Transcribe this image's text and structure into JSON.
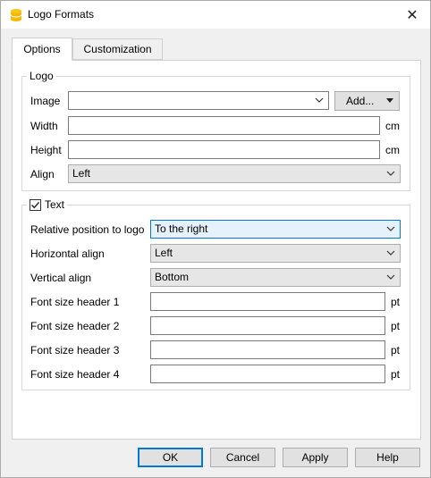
{
  "window": {
    "title": "Logo Formats",
    "close_symbol": "✕"
  },
  "tabs": [
    {
      "label": "Options",
      "active": true
    },
    {
      "label": "Customization",
      "active": false
    }
  ],
  "logo_group": {
    "title": "Logo",
    "image": {
      "label": "Image",
      "value": ""
    },
    "add_button": "Add...",
    "width": {
      "label": "Width",
      "value": "",
      "unit": "cm"
    },
    "height": {
      "label": "Height",
      "value": "",
      "unit": "cm"
    },
    "align": {
      "label": "Align",
      "value": "Left"
    }
  },
  "text_group": {
    "title": "Text",
    "checked": true,
    "relative_position": {
      "label": "Relative position to logo",
      "value": "To the right"
    },
    "horizontal_align": {
      "label": "Horizontal align",
      "value": "Left"
    },
    "vertical_align": {
      "label": "Vertical align",
      "value": "Bottom"
    },
    "font_size_1": {
      "label": "Font size header 1",
      "value": "",
      "unit": "pt"
    },
    "font_size_2": {
      "label": "Font size header 2",
      "value": "",
      "unit": "pt"
    },
    "font_size_3": {
      "label": "Font size header 3",
      "value": "",
      "unit": "pt"
    },
    "font_size_4": {
      "label": "Font size header 4",
      "value": "",
      "unit": "pt"
    }
  },
  "buttons": {
    "ok": "OK",
    "cancel": "Cancel",
    "apply": "Apply",
    "help": "Help"
  },
  "colors": {
    "accent": "#0078d7",
    "focus_fill": "#e5f1fb",
    "app_icon": "#f5c518"
  }
}
